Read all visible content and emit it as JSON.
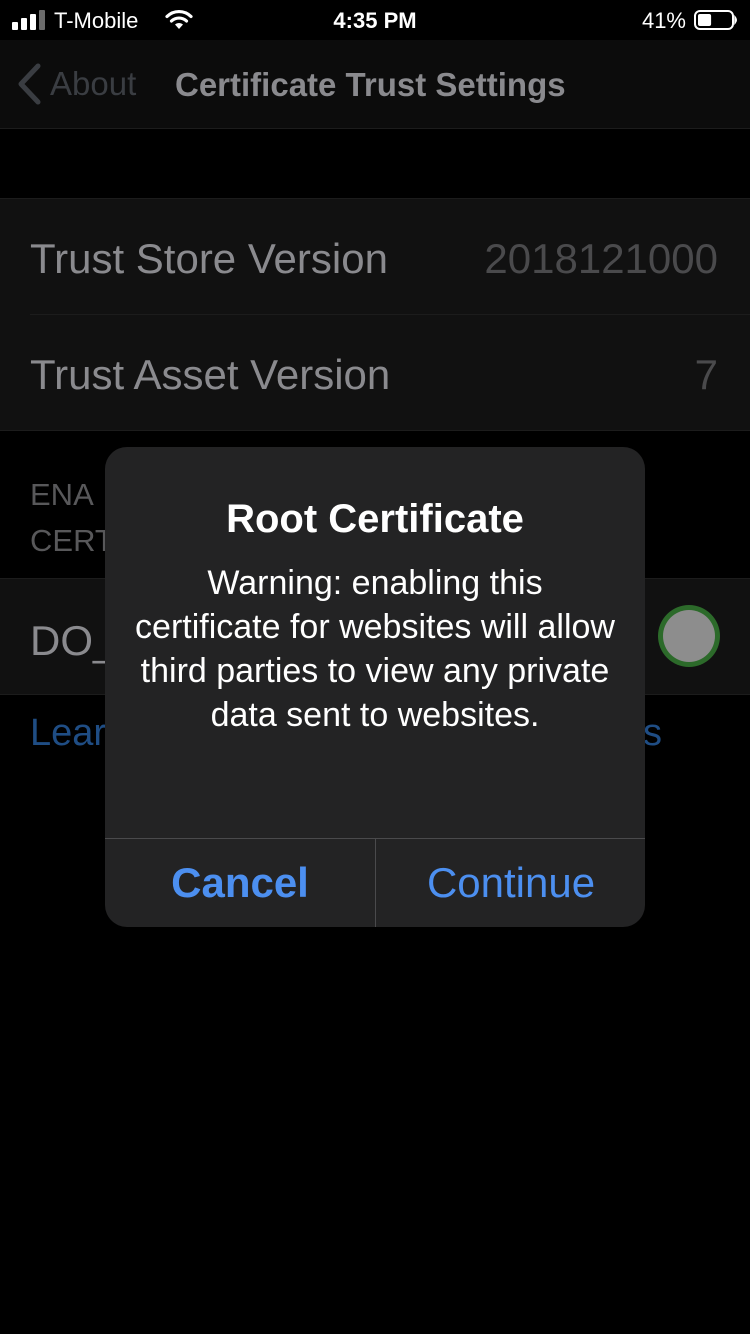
{
  "status_bar": {
    "carrier": "T-Mobile",
    "time": "4:35 PM",
    "battery_percent": "41%",
    "battery_level": 0.41,
    "signal_bars": 3,
    "signal_bars_total": 4,
    "icons": [
      "signal-icon",
      "wifi-icon",
      "battery-icon"
    ]
  },
  "nav": {
    "back_label": "About",
    "title": "Certificate Trust Settings",
    "back_icon": "chevron-left-icon"
  },
  "versions": [
    {
      "label": "Trust Store Version",
      "value": "2018121000"
    },
    {
      "label": "Trust Asset Version",
      "value": "7"
    }
  ],
  "section_header_visible": "ENA\nCERT",
  "certificate_toggle": {
    "label_visible": "DO_",
    "enabled": true,
    "on_color": "#2c6a2a"
  },
  "learn_more": {
    "text_left_visible": "Lear",
    "text_right_visible": "s"
  },
  "alert": {
    "title": "Root Certificate",
    "message": "Warning: enabling this certificate for websites will allow third parties to view any private data sent to websites.",
    "cancel_label": "Cancel",
    "continue_label": "Continue",
    "button_color": "#4c8ff0"
  }
}
